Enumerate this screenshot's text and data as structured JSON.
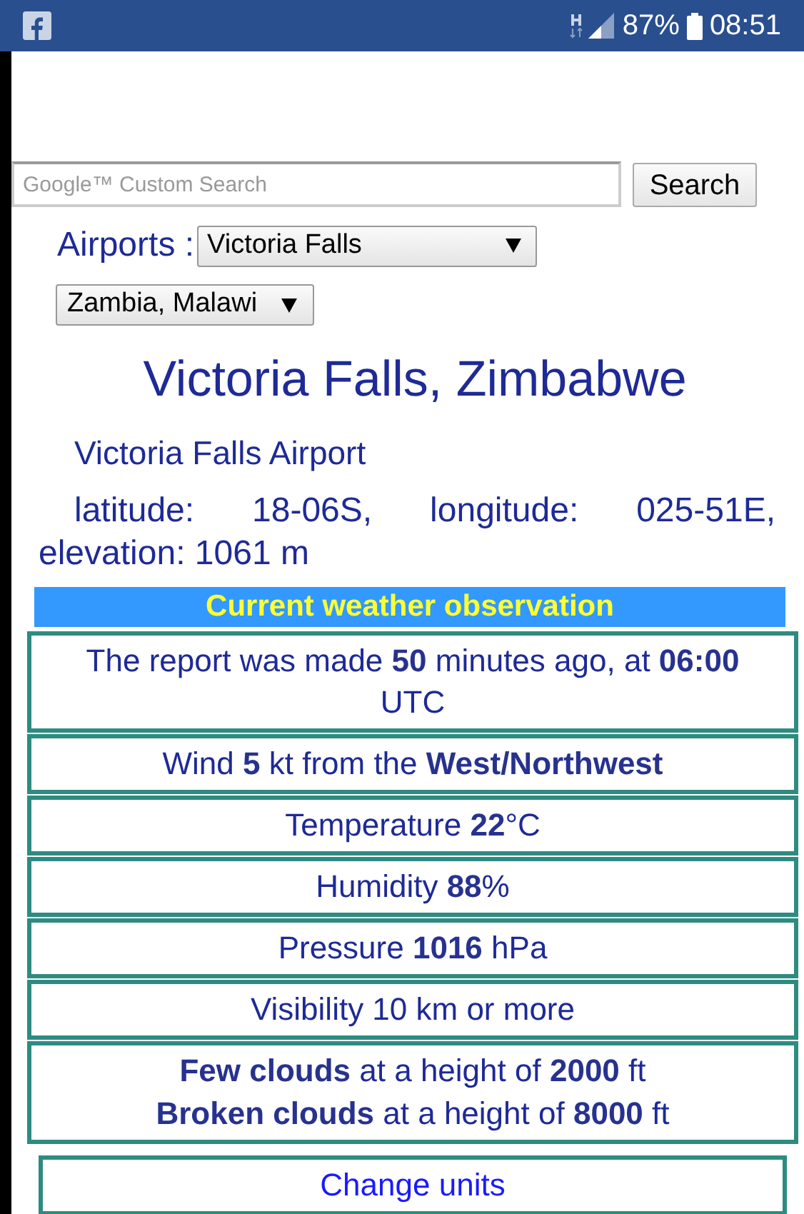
{
  "status_bar": {
    "battery": "87%",
    "time": "08:51"
  },
  "search": {
    "placeholder": "Google™ Custom Search",
    "button": "Search"
  },
  "airports": {
    "label": "Airports :",
    "airport_select": "Victoria Falls",
    "region_select": "Zambia, Malawi"
  },
  "station": {
    "title": "Victoria Falls, Zimbabwe",
    "airport": "Victoria Falls Airport",
    "location": "latitude: 18-06S, longitude: 025-51E, elevation: 1061 m"
  },
  "observation": {
    "heading": "Current weather observation",
    "rows": [
      [
        "The report was made **50** minutes ago, at **06:00** UTC"
      ],
      [
        "Wind **5** kt from the **West/Northwest**"
      ],
      [
        "Temperature **22**°C"
      ],
      [
        "Humidity **88**%"
      ],
      [
        "Pressure **1016** hPa"
      ],
      [
        "Visibility 10 km or more"
      ],
      [
        "**Few clouds** at a height of **2000** ft",
        "**Broken clouds** at a height of **8000** ft"
      ]
    ]
  },
  "change_units": "Change units"
}
